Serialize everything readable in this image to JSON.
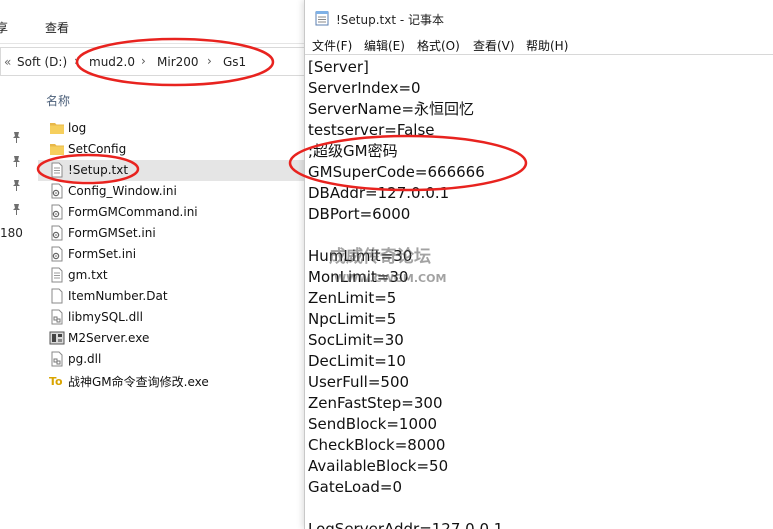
{
  "explorer": {
    "ribbon_tabs": [
      "享",
      "查看"
    ],
    "breadcrumb": {
      "back_glyph": "«",
      "items": [
        "Soft (D:)",
        "mud2.0",
        "Mir200",
        "Gs1"
      ],
      "separator": "›"
    },
    "nav_fragment": "180",
    "column_header": "名称",
    "files": [
      {
        "name": "log",
        "icon": "folder-icon"
      },
      {
        "name": "SetConfig",
        "icon": "folder-icon"
      },
      {
        "name": "!Setup.txt",
        "icon": "text-file-icon",
        "selected": true
      },
      {
        "name": "Config_Window.ini",
        "icon": "config-file-icon"
      },
      {
        "name": "FormGMCommand.ini",
        "icon": "config-file-icon"
      },
      {
        "name": "FormGMSet.ini",
        "icon": "config-file-icon"
      },
      {
        "name": "FormSet.ini",
        "icon": "config-file-icon"
      },
      {
        "name": "gm.txt",
        "icon": "text-file-icon"
      },
      {
        "name": "ItemNumber.Dat",
        "icon": "blank-file-icon"
      },
      {
        "name": "libmySQL.dll",
        "icon": "dll-file-icon"
      },
      {
        "name": "M2Server.exe",
        "icon": "server-exe-icon"
      },
      {
        "name": "pg.dll",
        "icon": "dll-file-icon"
      },
      {
        "name": "战神GM命令查询修改.exe",
        "icon": "tools-exe-icon"
      }
    ]
  },
  "notepad": {
    "title": "!Setup.txt - 记事本",
    "menu": [
      "文件(F)",
      "编辑(E)",
      "格式(O)",
      "查看(V)",
      "帮助(H)"
    ],
    "lines": [
      "[Server]",
      "ServerIndex=0",
      "ServerName=永恒回忆",
      "testserver=False",
      ";超级GM密码",
      "GMSuperCode=666666",
      "DBAddr=127.0.0.1",
      "DBPort=6000",
      "",
      "HumLimit=30",
      "MonLimit=30",
      "ZenLimit=5",
      "NpcLimit=5",
      "SocLimit=30",
      "DecLimit=10",
      "UserFull=500",
      "ZenFastStep=300",
      "SendBlock=1000",
      "CheckBlock=8000",
      "AvailableBlock=50",
      "GateLoad=0",
      "",
      "LogServerAddr=127.0.0.1"
    ]
  },
  "watermark": {
    "line1": "成威传奇论坛",
    "line2": "WWW.CWGM.COM"
  },
  "colors": {
    "annotation": "#e8231f",
    "selection": "#e5e5e5",
    "folder": "#e8b84a"
  }
}
